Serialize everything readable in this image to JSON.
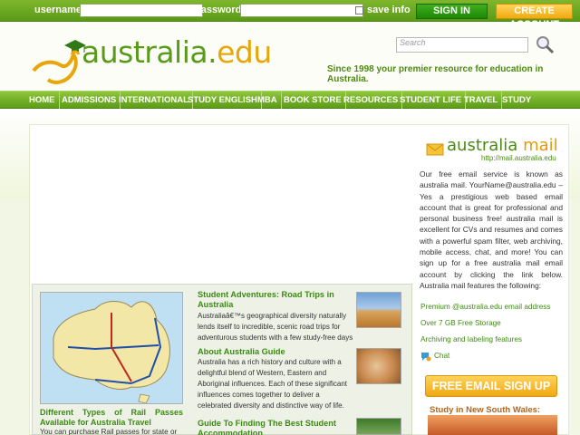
{
  "login": {
    "username_label": "username",
    "password_label": "password",
    "save_info_label": "save info",
    "signin_label": "SIGN IN",
    "create_label": "CREATE ACCOUNT"
  },
  "header": {
    "logo_main": "australia",
    "logo_dot": ".",
    "logo_edu": "edu",
    "search_placeholder": "Search",
    "tagline": "Since 1998 your premier resource for education in Australia."
  },
  "nav": [
    "HOME",
    "ADMISSIONS",
    "INTERNATIONAL",
    "STUDY ENGLISH",
    "MBA",
    "BOOK STORE",
    "RESOURCES",
    "STUDENT LIFE",
    "TRAVEL",
    "STUDY"
  ],
  "mail": {
    "title_a": "australia",
    "title_b": "mail",
    "url": "http://mail.australia.edu",
    "description": "Our free email service is known as australia mail. YourName@australia.edu – Yes a prestigious web based email account that is great for professional and personal business free! australia mail is excellent for CVs and resumes and comes with a powerful spam filter, web archiving, mobile access, chat, and more! You can sign up for a free australia mail email account by clicking the link below. Australia mail features the following:",
    "features": [
      "Premium @australia.edu email address",
      "Over 7 GB Free Storage",
      "Archiving and labeling features"
    ],
    "chat": "Chat",
    "signup": "FREE EMAIL SIGN UP",
    "nsw_title": "Study in New South Wales:"
  },
  "feature": {
    "map_caption": "Different Types of Rail Passes Available for Australia Travel",
    "map_text": "You can purchase Rail passes for state or",
    "items": [
      {
        "title": "Student Adventures: Road Trips in Australia",
        "text": "Australiaâ€™s geographical diversity naturally lends itself to incredible, scenic road trips for adventurous students with a few study-free days"
      },
      {
        "title": "About Australia Guide",
        "text": "Australia has a rich history and culture with a delightful blend of Western, Eastern and Aboriginal influences. Each of these significant influences comes together to deliver a celebrated diversity and distinctive way of life."
      },
      {
        "title": "Guide To Finding The Best Student Accommodation",
        "text": ""
      }
    ]
  },
  "colors": {
    "brand_green": "#5a9a1a",
    "accent_orange": "#e8a60a",
    "nav_green": "#6aa822"
  }
}
